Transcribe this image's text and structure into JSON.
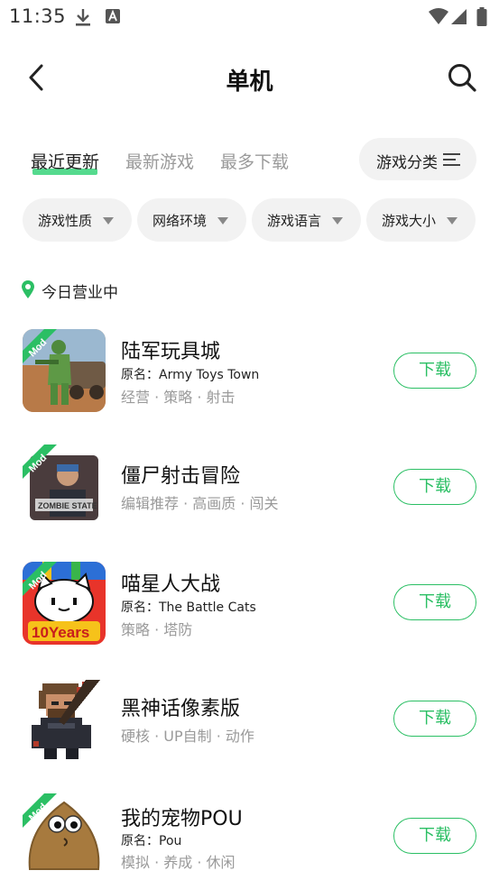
{
  "status_bar": {
    "time": "11:35"
  },
  "header": {
    "title": "单机"
  },
  "sort_tabs": [
    {
      "label": "最近更新",
      "active": true
    },
    {
      "label": "最新游戏",
      "active": false
    },
    {
      "label": "最多下载",
      "active": false
    }
  ],
  "category_button": {
    "label": "游戏分类"
  },
  "filters": [
    {
      "label": "游戏性质"
    },
    {
      "label": "网络环境"
    },
    {
      "label": "游戏语言"
    },
    {
      "label": "游戏大小"
    }
  ],
  "section": {
    "label": "今日营业中"
  },
  "games": [
    {
      "name": "陆军玩具城",
      "original": "原名：Army Toys Town",
      "tags": "经营 · 策略 · 射击",
      "mod_badge": "Mod",
      "download_label": "下载"
    },
    {
      "name": "僵尸射击冒险",
      "original": "",
      "tags": "编辑推荐 · 高画质 · 闯关",
      "mod_badge": "Mod",
      "download_label": "下载"
    },
    {
      "name": "喵星人大战",
      "original": "原名：The Battle Cats",
      "tags": "策略 · 塔防",
      "mod_badge": "Mod",
      "download_label": "下载"
    },
    {
      "name": "黑神话像素版",
      "original": "",
      "tags": "硬核 · UP自制 · 动作",
      "mod_badge": "",
      "download_label": "下载"
    },
    {
      "name": "我的宠物POU",
      "original": "原名：Pou",
      "tags": "模拟 · 养成 · 休闲",
      "mod_badge": "Mod",
      "download_label": "下载"
    }
  ],
  "colors": {
    "accent": "#2bbf64",
    "highlight": "#37d37a",
    "muted_text": "#9a9a9a",
    "chip_bg": "#f2f2f2"
  }
}
